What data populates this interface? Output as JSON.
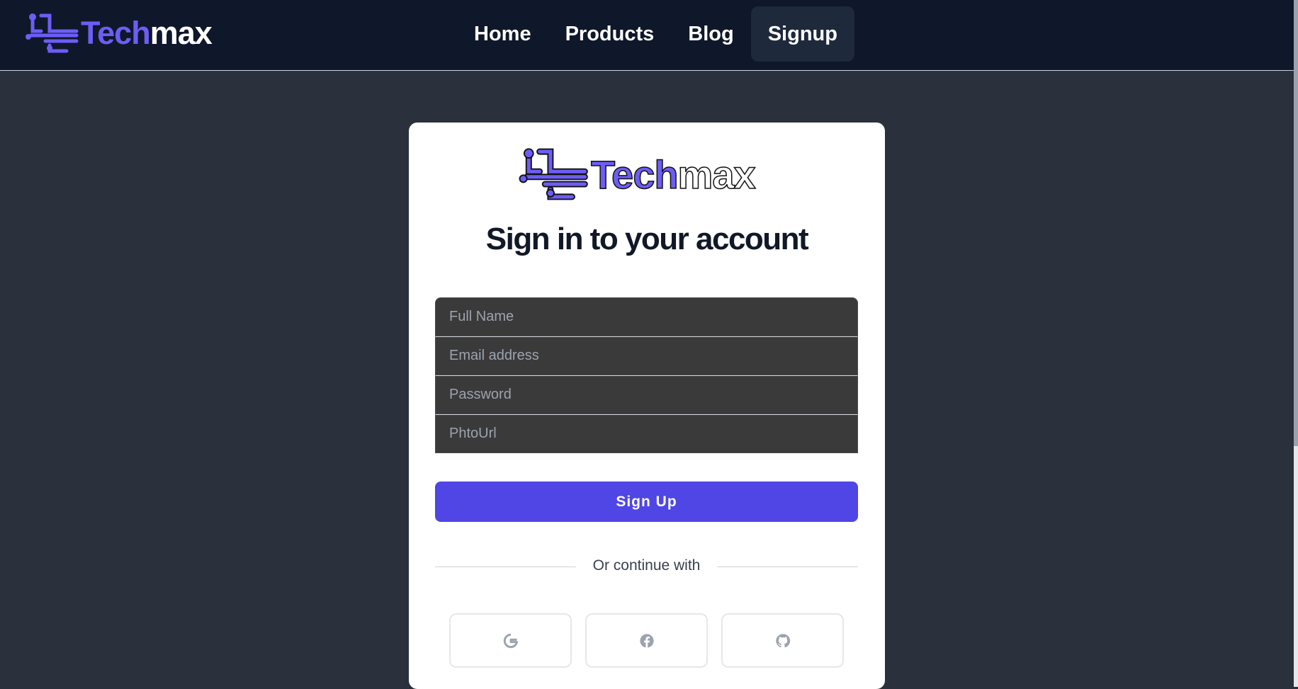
{
  "brand": {
    "name_part1": "Tech",
    "name_part2": "max",
    "accent_color": "#6d5df6"
  },
  "nav": {
    "items": [
      {
        "label": "Home"
      },
      {
        "label": "Products"
      },
      {
        "label": "Blog"
      },
      {
        "label": "Signup",
        "active": true
      }
    ]
  },
  "card": {
    "title": "Sign in to your account",
    "fields": [
      {
        "placeholder": "Full Name",
        "value": ""
      },
      {
        "placeholder": "Email address",
        "value": ""
      },
      {
        "placeholder": "Password",
        "value": ""
      },
      {
        "placeholder": "PhtoUrl",
        "value": ""
      }
    ],
    "submit_label": "Sign Up",
    "submit_color": "#4f46e5",
    "divider_text": "Or continue with",
    "socials": [
      {
        "icon": "google-icon"
      },
      {
        "icon": "facebook-icon"
      },
      {
        "icon": "github-icon"
      }
    ]
  }
}
